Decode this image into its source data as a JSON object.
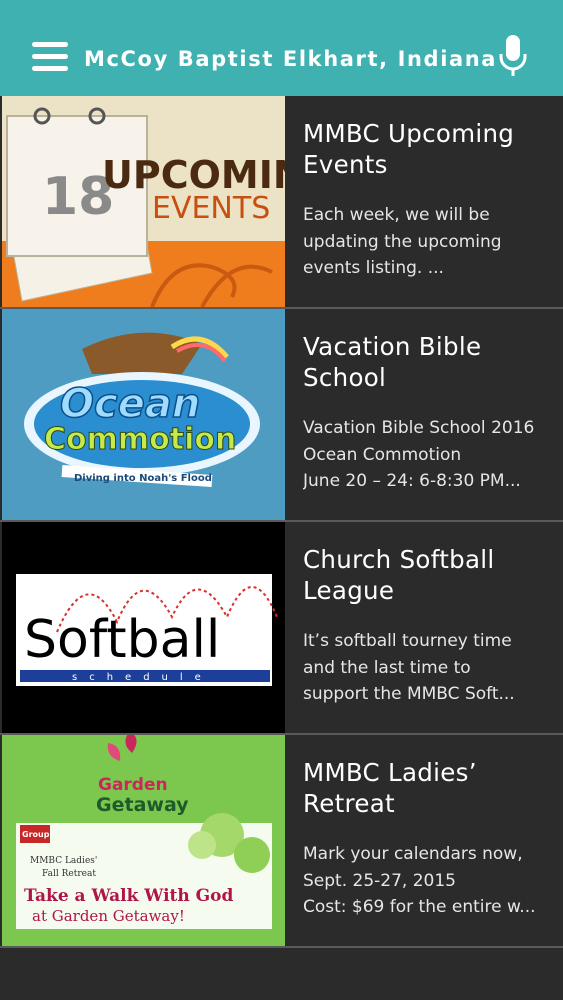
{
  "header": {
    "title": "McCoy Baptist Elkhart, Indiana",
    "menu_icon": "hamburger-menu-icon",
    "mic_icon": "microphone-icon",
    "accent": "#3fb1b1"
  },
  "items": [
    {
      "title": "MMBC Upcoming Events",
      "desc": [
        "Each week, we will be",
        "updating the upcoming",
        "events listing. ..."
      ],
      "image": {
        "number": "18",
        "line1": "UPCOMING",
        "line2": "EVENTS"
      }
    },
    {
      "title": "Vacation Bible School",
      "desc": [
        "Vacation Bible School 2016",
        "Ocean Commotion",
        "June 20 – 24: 6-8:30 PM..."
      ],
      "image": {
        "line1": "Ocean",
        "line2": "Commotion",
        "tagline": "Diving into Noah's Flood"
      }
    },
    {
      "title": "Church Softball League",
      "desc": [
        "It’s softball tourney time",
        "and the last time to",
        "support the MMBC Soft..."
      ],
      "image": {
        "word": "Softball",
        "sub": "schedule"
      }
    },
    {
      "title": "MMBC Ladies’ Retreat",
      "desc": [
        "Mark your calendars now,",
        "Sept. 25-27, 2015",
        "Cost: $69 for the entire w..."
      ],
      "image": {
        "brand_line1": "Garden",
        "brand_line2": "Getaway",
        "badge": "Group",
        "small_line1": "MMBC Ladies'",
        "small_line2": "Fall Retreat",
        "main_line1": "Take a Walk With God",
        "main_line2": "at Garden Getaway!"
      }
    }
  ]
}
